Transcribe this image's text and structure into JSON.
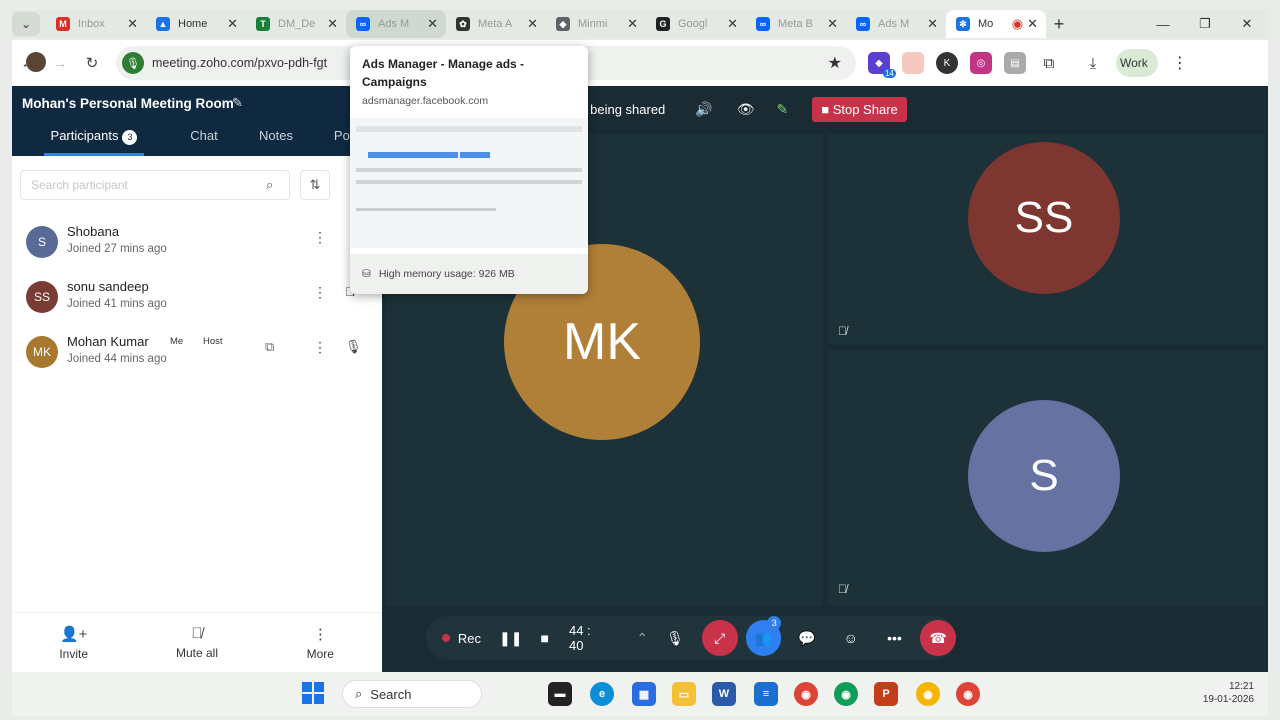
{
  "browser": {
    "tabs": [
      {
        "label": "Inbox",
        "icon": "gmail-icon",
        "color": "#d93025"
      },
      {
        "label": "Home",
        "icon": "drive-icon",
        "color": "#1a73e8"
      },
      {
        "label": "DM_De",
        "icon": "sheets-icon",
        "color": "#188038"
      },
      {
        "label": "Ads M",
        "icon": "meta-icon",
        "color": "#0866ff"
      },
      {
        "label": "Meta A",
        "icon": "openai-icon",
        "color": "#333333"
      },
      {
        "label": "Minmi",
        "icon": "gem-icon",
        "color": "#5f6368"
      },
      {
        "label": "Googl",
        "icon": "google-icon",
        "color": "#202124"
      },
      {
        "label": "Meta B",
        "icon": "meta-icon",
        "color": "#0866ff"
      },
      {
        "label": "Ads M",
        "icon": "meta-icon",
        "color": "#0866ff"
      },
      {
        "label": "Mo",
        "icon": "zoho-icon",
        "color": "#1a73e8"
      }
    ],
    "address_url": "meeting.zoho.com/pxvo-pdh-fgt",
    "profile_label": "Work",
    "ext_badge": "14"
  },
  "hovercard": {
    "title": "Ads Manager - Manage ads - Campaigns",
    "url": "adsmanager.facebook.com",
    "memory": "High memory usage: 926 MB"
  },
  "meeting": {
    "room_title": "Mohan's Personal Meeting Room",
    "tabs": {
      "participants": "Participants",
      "participants_count": "3",
      "chat": "Chat",
      "notes": "Notes",
      "polls": "Polls"
    },
    "search_placeholder": "Search participant",
    "participants": [
      {
        "initials": "S",
        "name": "Shobana",
        "joined": "Joined 27 mins ago",
        "color": "#5a6a96"
      },
      {
        "initials": "SS",
        "name": "sonu sandeep",
        "joined": "Joined 41 mins ago",
        "color": "#7a3b34"
      },
      {
        "initials": "MK",
        "name": "Mohan Kumar",
        "joined": "Joined 44 mins ago",
        "color": "#a8782f",
        "tag_me": "Me",
        "tag_host": "Host"
      }
    ],
    "footer": {
      "invite": "Invite",
      "mute_all": "Mute all",
      "more": "More"
    },
    "share_status": "s being shared",
    "stop_share": "Stop Share",
    "tiles": [
      {
        "initials": "MK",
        "color": "#b07f38"
      },
      {
        "initials": "SS",
        "color": "#7d3630"
      },
      {
        "initials": "S",
        "color": "#6672a2"
      }
    ],
    "recording_label": "Rec",
    "timer": "44 : 40",
    "participants_badge": "3"
  },
  "taskbar": {
    "search_label": "Search",
    "time": "12:21",
    "date": "19-01-2026"
  }
}
